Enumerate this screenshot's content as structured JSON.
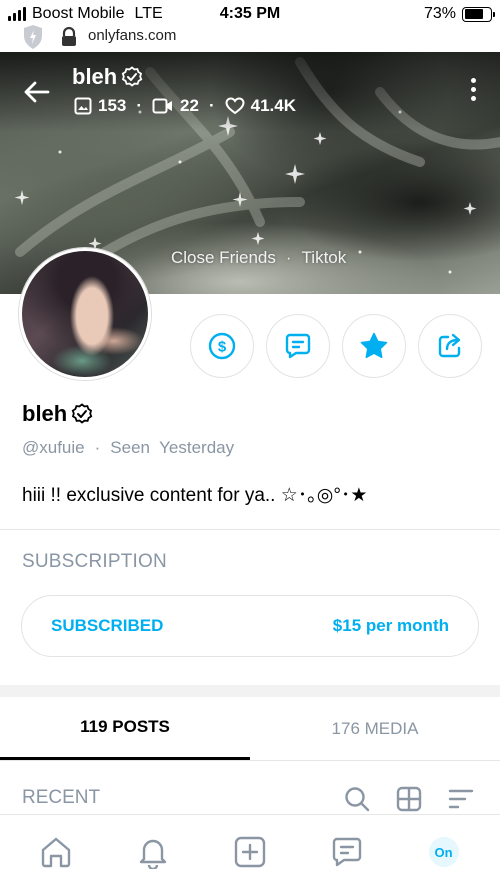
{
  "status_bar": {
    "carrier": "Boost Mobile",
    "network": "LTE",
    "time": "4:35 PM",
    "battery_percent": "73%",
    "battery_level": 0.73
  },
  "browser": {
    "url": "onlyfans.com"
  },
  "cover": {
    "name": "bleh",
    "stats": {
      "photos": "153",
      "videos": "22",
      "likes": "41.4K"
    },
    "links": [
      "Close Friends",
      "Tiktok"
    ],
    "separator": "·"
  },
  "profile": {
    "name": "bleh",
    "handle": "@xufuie",
    "seen_label": "Seen",
    "seen_value": "Yesterday",
    "separator": "·",
    "bio": "hiii !! exclusive content for ya.. ☆･｡◎°･★"
  },
  "subscription": {
    "section_title": "SUBSCRIPTION",
    "status_label": "SUBSCRIBED",
    "price_label": "$15 per month"
  },
  "tabs": [
    {
      "label": "119 POSTS",
      "active": true
    },
    {
      "label": "176 MEDIA",
      "active": false
    }
  ],
  "recent": {
    "title": "RECENT"
  },
  "bottom_nav": {
    "on_label": "On"
  },
  "colors": {
    "accent": "#00aff0",
    "muted": "#8a96a3",
    "border": "#e3e3e3"
  }
}
